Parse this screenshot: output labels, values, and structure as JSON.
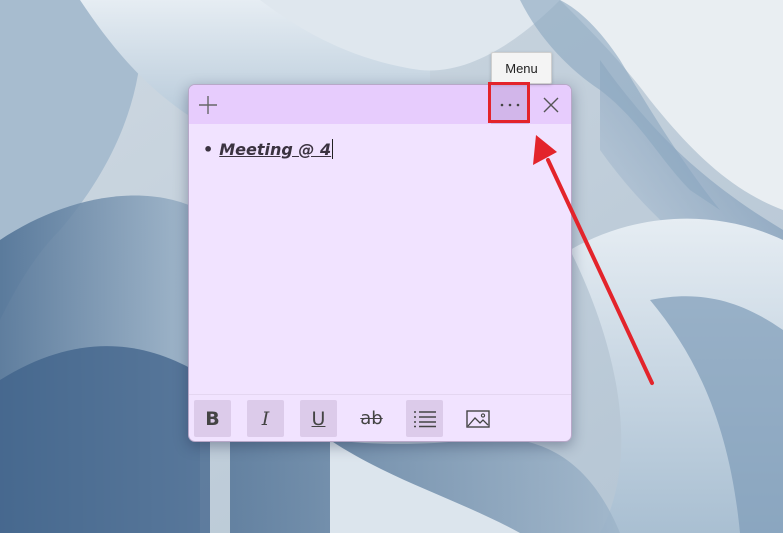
{
  "sticky_note": {
    "titlebar": {
      "add_icon": "plus-icon",
      "menu_icon": "more-horizontal-icon",
      "close_icon": "close-icon"
    },
    "content": {
      "bullet": "•",
      "text": "Meeting @ 4"
    },
    "toolbar": {
      "bold": "B",
      "italic": "I",
      "underline": "U",
      "strikethrough": "ab",
      "list_icon": "bullet-list-icon",
      "image_icon": "image-icon"
    },
    "colors": {
      "titlebar": "#e7ccfd",
      "body": "#f1e3ff"
    }
  },
  "tooltip": {
    "text": "Menu"
  },
  "annotation": {
    "color": "#e3242b"
  }
}
